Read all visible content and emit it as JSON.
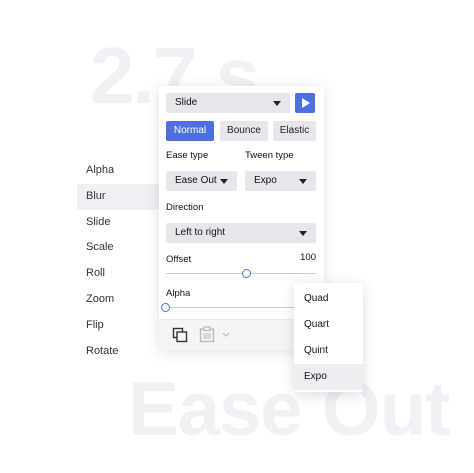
{
  "background": {
    "time_text": "2.7 s",
    "ease_text": "Ease Out"
  },
  "side_list": {
    "items": [
      {
        "label": "Alpha",
        "active": false
      },
      {
        "label": "Blur",
        "active": true
      },
      {
        "label": "Slide",
        "active": false
      },
      {
        "label": "Scale",
        "active": false
      },
      {
        "label": "Roll",
        "active": false
      },
      {
        "label": "Zoom",
        "active": false
      },
      {
        "label": "Flip",
        "active": false
      },
      {
        "label": "Rotate",
        "active": false
      }
    ]
  },
  "panel": {
    "animation_select": {
      "value": "Slide",
      "icon": "chevron-down-icon"
    },
    "play_button": {
      "icon": "play-icon",
      "color": "#4e6fe0"
    },
    "modes": [
      {
        "label": "Normal",
        "active": true
      },
      {
        "label": "Bounce",
        "active": false
      },
      {
        "label": "Elastic",
        "active": false
      }
    ],
    "ease_type": {
      "label": "Ease type",
      "value": "Ease Out"
    },
    "tween_type": {
      "label": "Tween type",
      "value": "Expo"
    },
    "direction": {
      "label": "Direction",
      "value": "Left to right"
    },
    "offset": {
      "label": "Offset",
      "value": "100",
      "fraction": 0.54
    },
    "alpha": {
      "label": "Alpha",
      "fraction": 0.0
    },
    "footer": {
      "copy_icon": "copy-icon",
      "paste_icon": "clipboard-icon",
      "more_icon": "chevron-down-icon"
    }
  },
  "tween_dropdown": {
    "options": [
      {
        "label": "Quad",
        "active": false
      },
      {
        "label": "Quart",
        "active": false
      },
      {
        "label": "Quint",
        "active": false
      },
      {
        "label": "Expo",
        "active": true
      }
    ]
  },
  "colors": {
    "accent": "#4e6fe0",
    "field_bg": "#e6e7ec",
    "selected_bg": "#eef0f4"
  }
}
